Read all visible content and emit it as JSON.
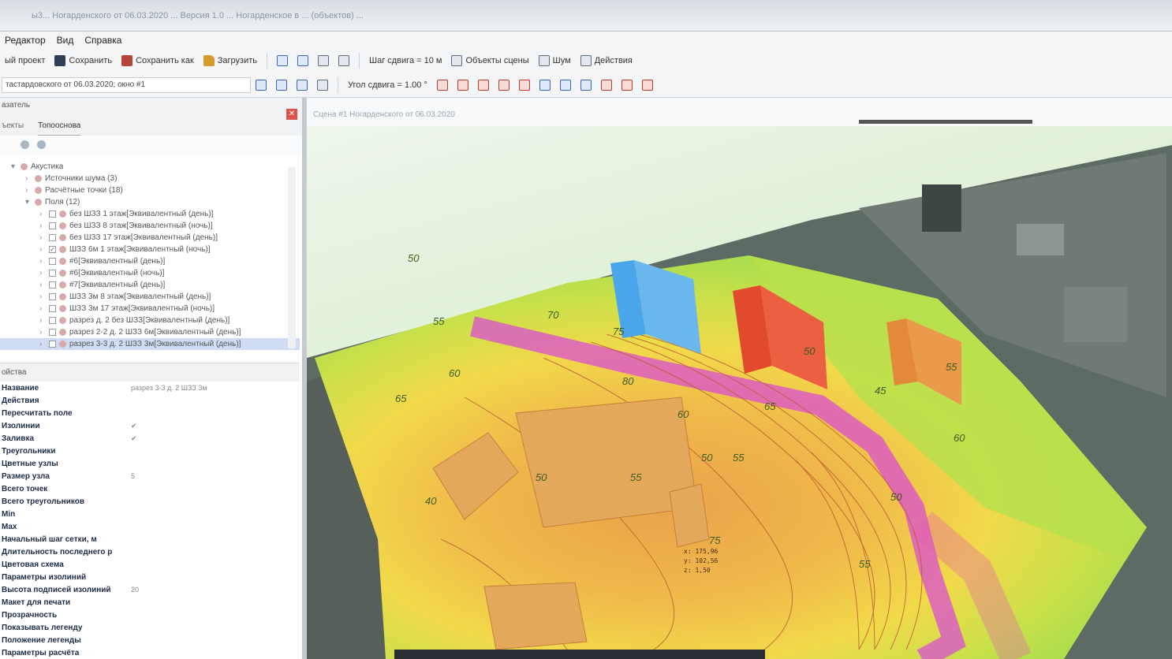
{
  "window": {
    "title": "ы3... Ногарденского от 06.03.2020 ... Версия 1.0 ... Ногарденское в ... (объектов) ..."
  },
  "menu": {
    "items": [
      "Редактор",
      "Вид",
      "Справка"
    ]
  },
  "toolbar": {
    "new_project": "ый проект",
    "save": "Сохранить",
    "save_as": "Сохранить как",
    "load": "Загрузить",
    "grid_step": "Шаг сдвига = 10 м",
    "scene_objects": "Объекты сцены",
    "noise": "Шум",
    "actions": "Действия",
    "angle_step": "Угол сдвига = 1.00 °",
    "project_select": "тастардовского от 06.03.2020; окно #1"
  },
  "panel": {
    "title": "азатель",
    "tabs": [
      "ъекты",
      "Топооснова"
    ],
    "tree": [
      {
        "label": "Акустика",
        "level": 0,
        "expanded": true
      },
      {
        "label": "Источники шума (3)",
        "level": 1
      },
      {
        "label": "Расчётные точки (18)",
        "level": 1
      },
      {
        "label": "Поля (12)",
        "level": 1,
        "expanded": true
      },
      {
        "label": "без ШЗЗ 1 этаж[Эквивалентный (день)]",
        "level": 2,
        "checked": false
      },
      {
        "label": "без ШЗЗ 8 этаж[Эквивалентный (ночь)]",
        "level": 2,
        "checked": false
      },
      {
        "label": "без ШЗЗ 17 этаж[Эквивалентный (день)]",
        "level": 2,
        "checked": false
      },
      {
        "label": "ШЗЗ 6м 1 этаж[Эквивалентный (ночь)]",
        "level": 2,
        "checked": true
      },
      {
        "label": "#6[Эквивалентный (день)]",
        "level": 2,
        "checked": false
      },
      {
        "label": "#6[Эквивалентный (ночь)]",
        "level": 2,
        "checked": false
      },
      {
        "label": "#7[Эквивалентный (день)]",
        "level": 2,
        "checked": false
      },
      {
        "label": "ШЗЗ 3м 8 этаж[Эквивалентный (день)]",
        "level": 2,
        "checked": false
      },
      {
        "label": "ШЗЗ 3м 17 этаж[Эквивалентный (ночь)]",
        "level": 2,
        "checked": false
      },
      {
        "label": "разрез д. 2 без ШЗЗ[Эквивалентный (день)]",
        "level": 2,
        "checked": false
      },
      {
        "label": "разрез 2-2 д. 2 ШЗЗ 6м[Эквивалентный (день)]",
        "level": 2,
        "checked": false
      },
      {
        "label": "разрез 3-3 д. 2 ШЗЗ 3м[Эквивалентный (день)]",
        "level": 2,
        "checked": false,
        "selected": true
      }
    ],
    "props_title": "ойства",
    "props": [
      {
        "name": "Название",
        "value": "разрез 3-3 д. 2 ШЗЗ 3м"
      },
      {
        "name": "Действия",
        "value": ""
      },
      {
        "name": "Пересчитать поле",
        "value": ""
      },
      {
        "name": "Изолинии",
        "value": "✔"
      },
      {
        "name": "Заливка",
        "value": "✔"
      },
      {
        "name": "Треугольники",
        "value": ""
      },
      {
        "name": "Цветные узлы",
        "value": ""
      },
      {
        "name": "Размер узла",
        "value": "5"
      },
      {
        "name": "Всего точек",
        "value": ""
      },
      {
        "name": "Всего треугольников",
        "value": ""
      },
      {
        "name": "Min",
        "value": ""
      },
      {
        "name": "Max",
        "value": ""
      },
      {
        "name": "Начальный шаг сетки, м",
        "value": ""
      },
      {
        "name": "Длительность последнего р",
        "value": ""
      },
      {
        "name": "Цветовая схема",
        "value": ""
      },
      {
        "name": "Параметры изолиний",
        "value": ""
      },
      {
        "name": "Высота подписей изолиний",
        "value": "20"
      },
      {
        "name": "Макет для печати",
        "value": ""
      },
      {
        "name": "Прозрачность",
        "value": ""
      },
      {
        "name": "Показывать легенду",
        "value": ""
      },
      {
        "name": "Положение легенды",
        "value": ""
      },
      {
        "name": "Параметры расчёта",
        "value": ""
      }
    ]
  },
  "view": {
    "title": "Сцена #1 Ногарденского от 06.03.2020",
    "isoline_labels": [
      "50",
      "55",
      "60",
      "65",
      "70",
      "75",
      "80",
      "60",
      "50",
      "55",
      "65",
      "50",
      "45",
      "55",
      "60",
      "50",
      "55",
      "40",
      "75",
      "50",
      "55"
    ],
    "point_readout": [
      "x: 175,96",
      "y: 102,56",
      "z: 1,50"
    ]
  },
  "colors": {
    "accent": "#3c66b8",
    "close": "#d9534f",
    "building_blue": "#4aa6e8",
    "building_red": "#e24a2e",
    "building_orange": "#e38a3a"
  }
}
